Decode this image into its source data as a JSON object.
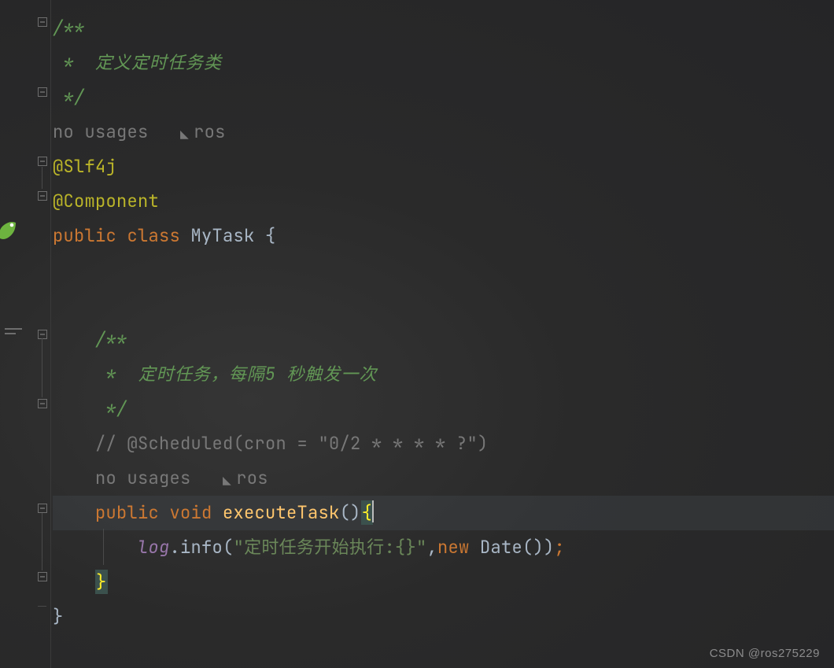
{
  "code": {
    "l1": "/**",
    "l2_prefix": " *  ",
    "l2_text": "定义定时任务类",
    "l3": " */",
    "l4_usages": "no usages",
    "l4_author": "ros",
    "l5": "@Slf4j",
    "l6": "@Component",
    "l7_public": "public",
    "l7_class": " class ",
    "l7_name": "MyTask ",
    "l7_brace": "{",
    "l8": "",
    "l9": "",
    "l10": "    /**",
    "l11_prefix": "     * ",
    "l11_text": " 定时任务，每隔",
    "l11_num": "5",
    "l11_text2": " 秒触发一次",
    "l12": "     */",
    "l13": "    // @Scheduled(cron = \"0/2 * * * * ?\")",
    "l14_usages": "no usages",
    "l14_author": "ros",
    "l15_public": "public",
    "l15_void": " void ",
    "l15_method": "executeTask",
    "l15_parens": "()",
    "l15_brace": "{",
    "l16_log": "log",
    "l16_dot": ".",
    "l16_info": "info",
    "l16_paren_open": "(",
    "l16_str": "\"定时任务开始执行:{}\"",
    "l16_comma": ",",
    "l16_new": "new ",
    "l16_date": "Date()",
    "l16_paren_close": ")",
    "l16_semi": ";",
    "l17": "    ",
    "l17_brace": "}",
    "l18": "}"
  },
  "watermark": "CSDN @ros275229"
}
